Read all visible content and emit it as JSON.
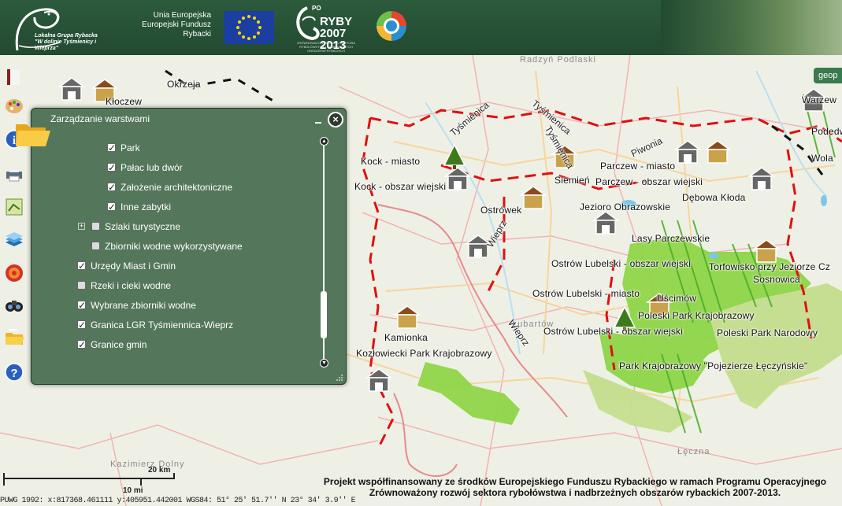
{
  "header": {
    "logo_title": "Lokalna Grupa Rybacka",
    "logo_tagline": "\"W dolinie Tyśmienicy i Wieprza\"",
    "eu_text": [
      "Unia Europejska",
      "Europejski Fundusz",
      "Rybacki"
    ],
    "po_top": "PO",
    "po_name": "RYBY",
    "po_years": [
      "2007",
      "2013"
    ],
    "po_small": "ZRÓWNOWAŻONY ROZWÓJ SEKTORA RYBOŁÓWSTWA I NADBRZEŻNYCH OBSZARÓW RYBACKICH"
  },
  "geo_tab": "geop",
  "toolbar": {
    "tools": [
      "book-icon",
      "palette-icon",
      "folder-icon",
      "info-icon",
      "printer-icon",
      "map-edit-icon",
      "layers-icon",
      "target-icon",
      "binoculars-icon",
      "folder-open-icon",
      "help-icon"
    ]
  },
  "panel": {
    "title": "Zarządzanie warstwami",
    "close_label": "×",
    "layers": [
      {
        "label": "Park",
        "checked": true,
        "indent": 2
      },
      {
        "label": "Pałac lub dwór",
        "checked": true,
        "indent": 2
      },
      {
        "label": "Założenie architektoniczne",
        "checked": true,
        "indent": 2
      },
      {
        "label": "Inne zabytki",
        "checked": true,
        "indent": 2
      },
      {
        "label": "Szlaki turystyczne",
        "checked": false,
        "indent": 1,
        "expandable": true
      },
      {
        "label": "Zbiorniki wodne wykorzystywane",
        "checked": false,
        "indent": 1
      },
      {
        "label": "Urzędy Miast i Gmin",
        "checked": true,
        "indent": 0
      },
      {
        "label": "Rzeki i cieki wodne",
        "checked": false,
        "indent": 0
      },
      {
        "label": "Wybrane zbiorniki wodne",
        "checked": true,
        "indent": 0
      },
      {
        "label": "Granica LGR Tyśmiennica-Wieprz",
        "checked": true,
        "indent": 0
      },
      {
        "label": "Granice gmin",
        "checked": true,
        "indent": 0
      }
    ],
    "expand_symbol": "+"
  },
  "map": {
    "places": [
      "Kock - miasto",
      "Kock - obszar wiejski",
      "Ostrówek",
      "Parczew - miasto",
      "Parczew - obszar wiejski",
      "Siemień",
      "Jezioro Obrazowskie",
      "Dębowa Kłoda",
      "Lasy Parczewskie",
      "Ostrów Lubelski - obszar wiejski",
      "Ostrów Lubelski - miasto",
      "Torfowisko przy Jeziorze Cz",
      "Sosnowica",
      "Uścimów",
      "Poleski Park Krajobrazowy",
      "Poleski Park Narodowy",
      "Ostrów Lubelski - obszar wiejski",
      "Park Krajobrazowy \"Pojezierze Łęczyńskie\"",
      "Kamionka",
      "Kozłowiecki Park Krajobrazowy",
      "Kłoczew",
      "Okrzeja",
      "Warzew",
      "Podedwórz",
      "Wola"
    ],
    "towns": [
      "Radzyń Podlaski",
      "Tyśmienica",
      "Tyśmienica",
      "Piwonia",
      "Wieprz",
      "Tyśmienica",
      "Łęczna",
      "Kazimierz Dolny",
      "Wieprz",
      "Lubartów"
    ]
  },
  "scale": {
    "km_label": "20 km",
    "mi_label": "10 mi"
  },
  "coords": "PUWG 1992: x:817368.461111   y:405951.442001  WGS84: 51° 25' 51.7'' N   23° 34' 3.9'' E",
  "footer": {
    "line1": "Projekt współfinansowany ze środków Europejskiego Funduszu Rybackiego w ramach Programu Operacyjnego",
    "line2": "Zrównoważony rozwój sektora rybołówstwa i nadbrzeżnych obszarów rybackich 2007-2013."
  },
  "colors": {
    "header": "#2c5a3c",
    "panel": "#3f6448",
    "green_area": "#8fd548",
    "boundary": "#e01010"
  }
}
